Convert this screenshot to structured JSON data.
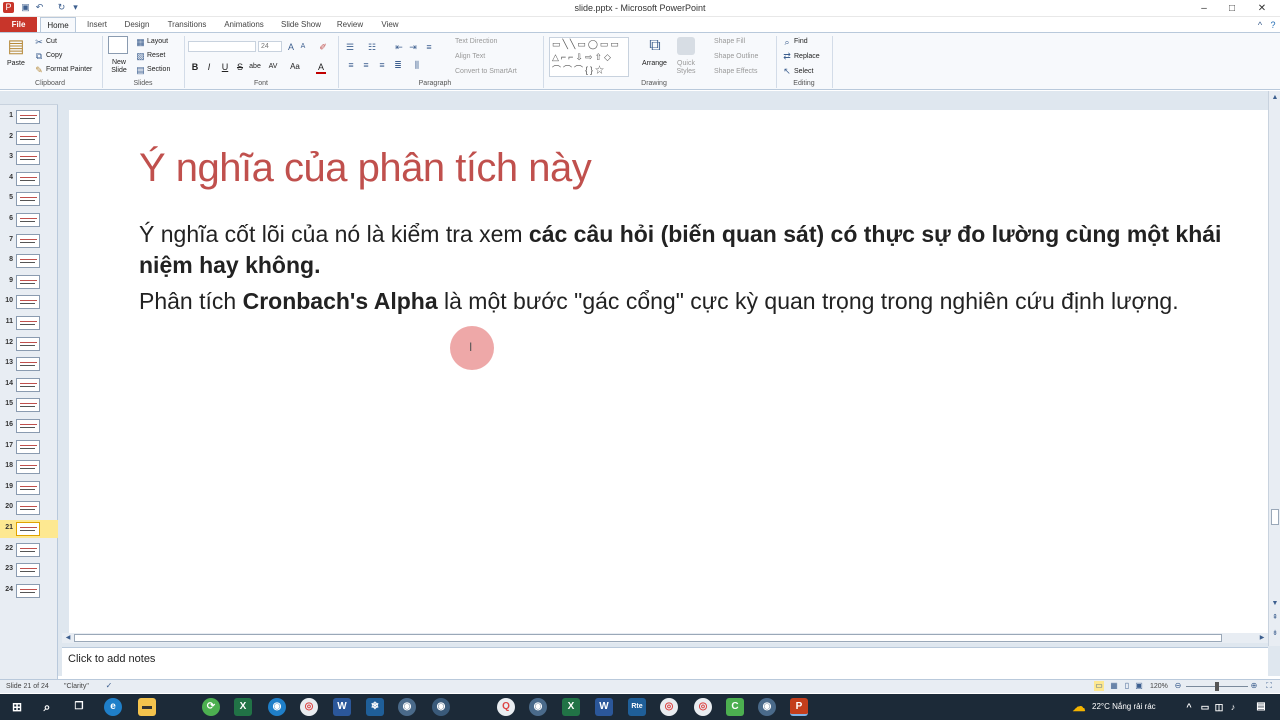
{
  "window": {
    "title": "slide.pptx - Microsoft PowerPoint",
    "controls": [
      "–",
      "□",
      "✕"
    ]
  },
  "tabs": [
    "File",
    "Home",
    "Insert",
    "Design",
    "Transitions",
    "Animations",
    "Slide Show",
    "Review",
    "View"
  ],
  "ribbon": {
    "clipboard": {
      "paste": "Paste",
      "cut": "Cut",
      "copy": "Copy",
      "format_painter": "Format Painter",
      "label": "Clipboard"
    },
    "slides": {
      "new_slide": "New Slide",
      "layout": "Layout",
      "reset": "Reset",
      "section": "Section",
      "label": "Slides"
    },
    "font": {
      "size": "24",
      "bold": "B",
      "italic": "I",
      "underline": "U",
      "strike": "S",
      "shadow": "abe",
      "spacing": "AV",
      "case": "Aa",
      "color": "A",
      "label": "Font"
    },
    "paragraph": {
      "text_direction": "Text Direction",
      "align_text": "Align Text",
      "convert_smartart": "Convert to SmartArt",
      "label": "Paragraph"
    },
    "drawing": {
      "arrange": "Arrange",
      "quick_styles": "Quick Styles",
      "shape_fill": "Shape Fill",
      "shape_outline": "Shape Outline",
      "shape_effects": "Shape Effects",
      "label": "Drawing"
    },
    "editing": {
      "find": "Find",
      "replace": "Replace",
      "select": "Select",
      "label": "Editing"
    }
  },
  "thumbnails": [
    "1",
    "2",
    "3",
    "4",
    "5",
    "6",
    "7",
    "8",
    "9",
    "10",
    "11",
    "12",
    "13",
    "14",
    "15",
    "16",
    "17",
    "18",
    "19",
    "20",
    "21",
    "22",
    "23",
    "24"
  ],
  "selected_slide": 21,
  "slide": {
    "title": "Ý nghĩa của phân tích này",
    "p1_prefix": "Ý nghĩa cốt lõi của nó là kiểm tra xem ",
    "p1_bold": "các câu hỏi (biến quan sát) có thực sự đo lường cùng một khái niệm hay không.",
    "p2_prefix": "Phân tích ",
    "p2_bold": "Cronbach's Alpha",
    "p2_suffix": " là một bước \"gác cổng\" cực kỳ quan trọng trong nghiên cứu định lượng."
  },
  "notes": {
    "placeholder": "Click to add notes"
  },
  "status": {
    "slide_info": "Slide 21 of 24",
    "theme": "\"Clarity\"",
    "zoom": "120%"
  },
  "taskbar": {
    "weather": "22°C  Nắng rải rác",
    "time": "",
    "colors": {
      "word": "#2b579a",
      "excel": "#217346",
      "ppt": "#c43e1c"
    }
  }
}
